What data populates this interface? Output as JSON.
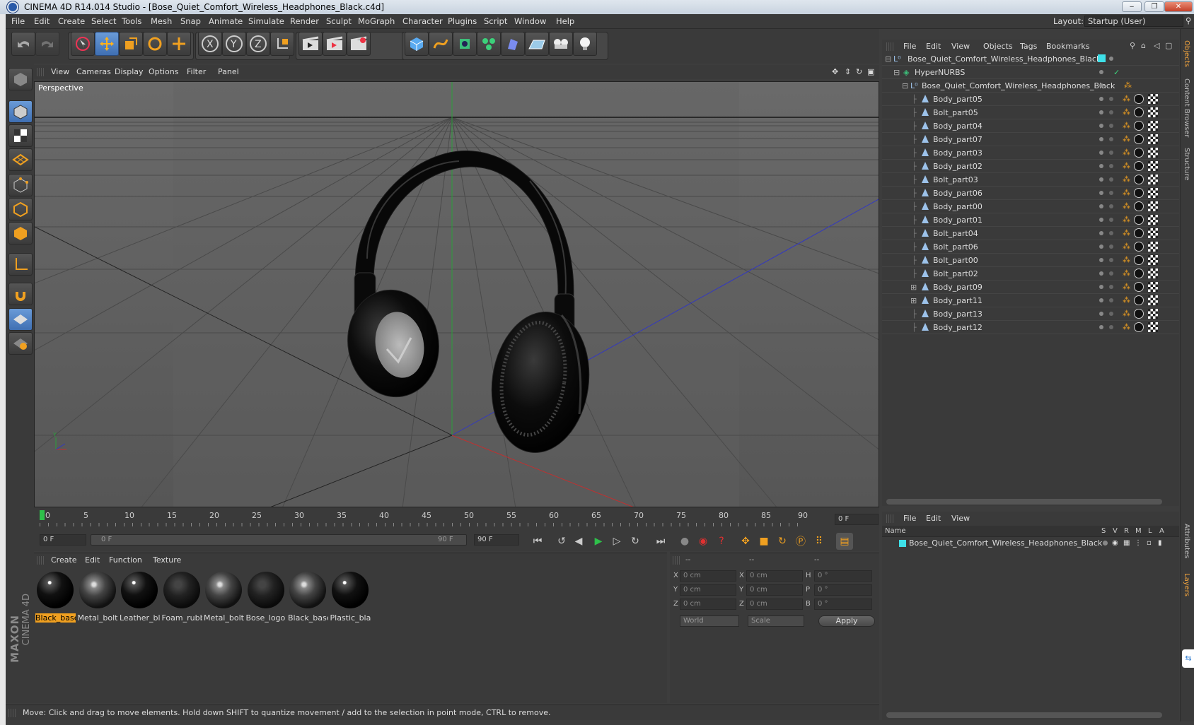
{
  "window": {
    "title": "CINEMA 4D R14.014 Studio - [Bose_Quiet_Comfort_Wireless_Headphones_Black.c4d]",
    "minimize": "‒",
    "restore": "❐",
    "close": "✕"
  },
  "menubar": {
    "items": [
      "File",
      "Edit",
      "Create",
      "Select",
      "Tools",
      "Mesh",
      "Snap",
      "Animate",
      "Simulate",
      "Render",
      "Sculpt",
      "MoGraph",
      "Character",
      "Plugins",
      "Script",
      "Window",
      "Help"
    ],
    "layout_label": "Layout:",
    "layout_value": "Startup (User)"
  },
  "viewport": {
    "menu": [
      "View",
      "Cameras",
      "Display",
      "Options",
      "Filter",
      "Panel"
    ],
    "label": "Perspective"
  },
  "timeline": {
    "ticks": [
      "0",
      "5",
      "10",
      "15",
      "20",
      "25",
      "30",
      "35",
      "40",
      "45",
      "50",
      "55",
      "60",
      "65",
      "70",
      "75",
      "80",
      "85",
      "90"
    ],
    "current_frame": "0 F",
    "start_field": "0 F",
    "range_start": "0 F",
    "range_end": "90 F",
    "end_field": "90 F"
  },
  "materials": {
    "menu": [
      "Create",
      "Edit",
      "Function",
      "Texture"
    ],
    "items": [
      {
        "name": "Black_base",
        "style": "black"
      },
      {
        "name": "Metal_bolt",
        "style": "metal"
      },
      {
        "name": "Leather_bla",
        "style": "black"
      },
      {
        "name": "Foam_rubb",
        "style": "dark"
      },
      {
        "name": "Metal_bolt",
        "style": "metal"
      },
      {
        "name": "Bose_logo",
        "style": "dark"
      },
      {
        "name": "Black_base",
        "style": "metal"
      },
      {
        "name": "Plastic_blac",
        "style": "black"
      }
    ]
  },
  "coords": {
    "headers": [
      "--",
      "--",
      "--"
    ],
    "rows": [
      {
        "a": "X",
        "av": "0 cm",
        "b": "X",
        "bv": "0 cm",
        "c": "H",
        "cv": "0 °"
      },
      {
        "a": "Y",
        "av": "0 cm",
        "b": "Y",
        "bv": "0 cm",
        "c": "P",
        "cv": "0 °"
      },
      {
        "a": "Z",
        "av": "0 cm",
        "b": "Z",
        "bv": "0 cm",
        "c": "B",
        "cv": "0 °"
      }
    ],
    "world": "World",
    "scale": "Scale",
    "apply": "Apply"
  },
  "objects": {
    "menu": [
      "File",
      "Edit",
      "View",
      "Objects",
      "Tags",
      "Bookmarks"
    ],
    "root": "Bose_Quiet_Comfort_Wireless_Headphones_Black",
    "hypernurbs": "HyperNURBS",
    "group": "Bose_Quiet_Comfort_Wireless_Headphones_Black",
    "children": [
      "Body_part05",
      "Bolt_part05",
      "Body_part04",
      "Body_part07",
      "Body_part03",
      "Body_part02",
      "Bolt_part03",
      "Body_part06",
      "Body_part00",
      "Body_part01",
      "Bolt_part04",
      "Bolt_part06",
      "Bolt_part00",
      "Bolt_part02",
      "Body_part09",
      "Body_part11",
      "Body_part13",
      "Body_part12"
    ]
  },
  "layers": {
    "menu": [
      "File",
      "Edit",
      "View"
    ],
    "columns": [
      "Name",
      "S",
      "V",
      "R",
      "M",
      "L",
      "A"
    ],
    "row": "Bose_Quiet_Comfort_Wireless_Headphones_Black"
  },
  "right_tabs": [
    "Objects",
    "Content Browser",
    "Structure",
    "Attributes",
    "Layers"
  ],
  "status": "Move: Click and drag to move elements. Hold down SHIFT to quantize movement / add to the selection in point mode, CTRL to remove.",
  "brand": {
    "line1": "MAXON",
    "line2": "CINEMA 4D"
  },
  "colors": {
    "accent": "#f0a020",
    "selected_tool": "#4f84c8",
    "viewport_bg": "#5d5d5d",
    "panel": "#3a3a3a"
  }
}
